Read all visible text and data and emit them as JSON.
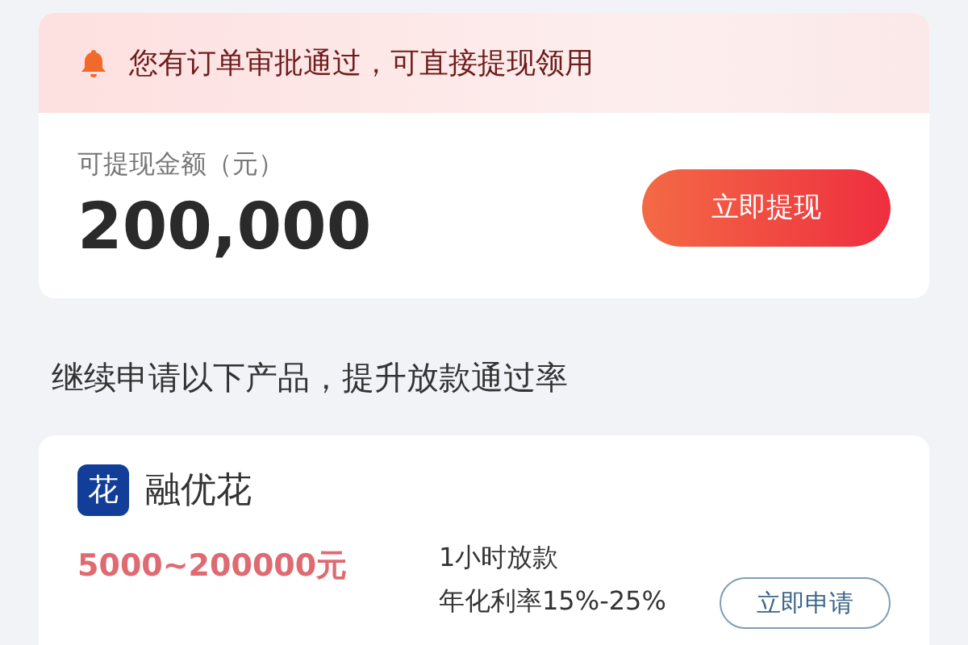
{
  "notice": {
    "text": "您有订单审批通过，可直接提现领用"
  },
  "withdraw": {
    "label": "可提现金额（元）",
    "amount": "200,000",
    "button": "立即提现"
  },
  "section_title": "继续申请以下产品，提升放款通过率",
  "products": [
    {
      "logo_text": "花",
      "name": "融优花",
      "range": "5000~200000元",
      "features": [
        "1小时放款",
        "年化利率15%-25%"
      ],
      "button": "立即申请"
    }
  ]
}
